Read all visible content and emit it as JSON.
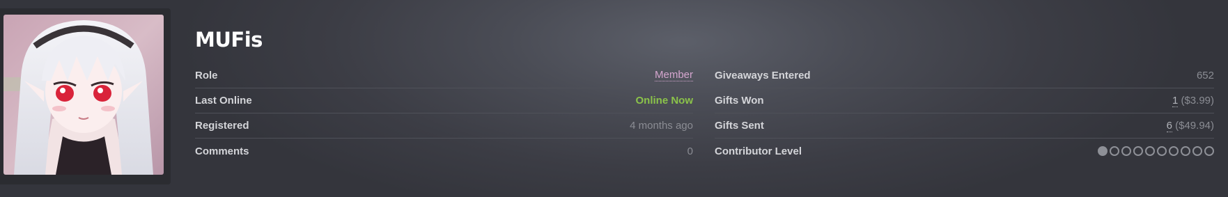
{
  "profile": {
    "username": "MUFis",
    "avatar_icon": "anime-avatar-icon"
  },
  "left_table": [
    {
      "label": "Role",
      "value": "Member"
    },
    {
      "label": "Last Online",
      "value": "Online Now"
    },
    {
      "label": "Registered",
      "value": "4 months ago"
    },
    {
      "label": "Comments",
      "value": "0"
    }
  ],
  "right_table": {
    "giveaways_entered": {
      "label": "Giveaways Entered",
      "value": "652"
    },
    "gifts_won": {
      "label": "Gifts Won",
      "count": "1",
      "amount": "($3.99)"
    },
    "gifts_sent": {
      "label": "Gifts Sent",
      "count": "6",
      "amount": "($49.94)"
    },
    "contributor_level": {
      "label": "Contributor Level",
      "level": 1,
      "max_level": 10
    }
  },
  "colors": {
    "role": "#d5a6cf",
    "online": "#8bc34a",
    "label": "#d4d5d9",
    "muted": "#8b8d94"
  }
}
